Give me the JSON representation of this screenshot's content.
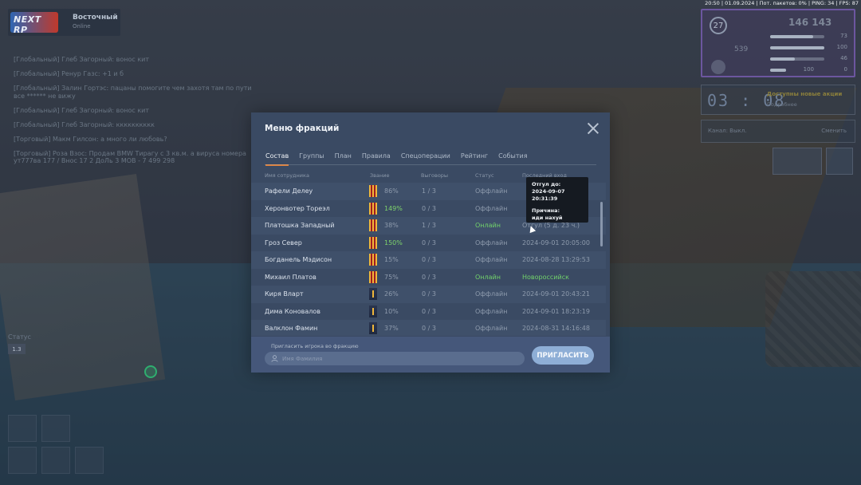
{
  "hud": {
    "topbar": "20:50 | 01.09.2024 | Пот. пакетов: 0% | PING: 34 | FPS: 87",
    "level": "27",
    "money": "146 143",
    "money2": "539",
    "bars": [
      "73",
      "100",
      "46",
      "0"
    ],
    "armor": "100",
    "timer_digits": "03 : 08",
    "timer_note": "Доступны новые акции",
    "timer_sub": "Подробнее",
    "mic_label": "Канал: Выкл.",
    "mic_action": "Сменить"
  },
  "server": {
    "logo": "NEXT RP",
    "name": "Восточный",
    "sub": "Online"
  },
  "chat": [
    "[Глобальный] Глеб Загорный: вонос кит",
    "[Глобальный] Ренур Газс: +1 и б",
    "[Глобальный] Залин Гортэс: пацаны помогите чем захотя там по пути все ****** не вижу",
    "[Глобальный] Глеб Загорный: вонос кит",
    "[Глобальный] Глеб Загорный: кккккккккк",
    "[Торговый] Макм Гилсон: а много ли любовь?",
    "[Торговый] Роза Взос: Продам BMW Тирагу с 3 кв.м. а вируса номера ут777ва 177 / Внос 17 2 ДоЛь 3 МОВ - 7 499 298"
  ],
  "status_widget": {
    "label": "Статус",
    "value": "1.3"
  },
  "modal": {
    "title": "Меню фракций",
    "tabs": [
      "Состав",
      "Группы",
      "План",
      "Правила",
      "Спецоперации",
      "Рейтинг",
      "События"
    ],
    "active_tab": "Состав",
    "columns": [
      "Имя сотрудника",
      "Звание",
      "Выговоры",
      "Статус",
      "Последний вход"
    ],
    "rows": [
      {
        "name": "Рафели Делеу",
        "rank": "red",
        "pct": "86%",
        "warn": "1 / 3",
        "status": "Оффлайн",
        "last": ""
      },
      {
        "name": "Херонвотер Тореэл",
        "rank": "red",
        "pct": "149%",
        "warn": "0 / 3",
        "status": "Оффлайн",
        "last": ""
      },
      {
        "name": "Платошка Западный",
        "rank": "red",
        "pct": "38%",
        "warn": "1 / 3",
        "status": "Онлайн",
        "last": "Отгул (5 д. 23 ч.)"
      },
      {
        "name": "Гроз Север",
        "rank": "red",
        "pct": "150%",
        "warn": "0 / 3",
        "status": "Оффлайн",
        "last": "2024-09-01 20:05:00"
      },
      {
        "name": "Богданель Мэдисон",
        "rank": "red",
        "pct": "15%",
        "warn": "0 / 3",
        "status": "Оффлайн",
        "last": "2024-08-28 13:29:53"
      },
      {
        "name": "Михаил Платов",
        "rank": "red",
        "pct": "75%",
        "warn": "0 / 3",
        "status": "Онлайн",
        "last": "Новороссийск"
      },
      {
        "name": "Киря Вларт",
        "rank": "blue",
        "pct": "26%",
        "warn": "0 / 3",
        "status": "Оффлайн",
        "last": "2024-09-01 20:43:21"
      },
      {
        "name": "Дима Коновалов",
        "rank": "blue",
        "pct": "10%",
        "warn": "0 / 3",
        "status": "Оффлайн",
        "last": "2024-09-01 18:23:19"
      },
      {
        "name": "Валклон Фамин",
        "rank": "blue",
        "pct": "37%",
        "warn": "0 / 3",
        "status": "Оффлайн",
        "last": "2024-08-31 14:16:48"
      }
    ],
    "invite_label": "Пригласить игрока во фракцию",
    "invite_placeholder": "Имя Фамилия",
    "invite_button": "ПРИГЛАСИТЬ"
  },
  "tooltip": {
    "until_label": "Отгул до:",
    "until_value": "2024-09-07 20:31:39",
    "reason_label": "Причина:",
    "reason_value": "иди нахуй"
  }
}
